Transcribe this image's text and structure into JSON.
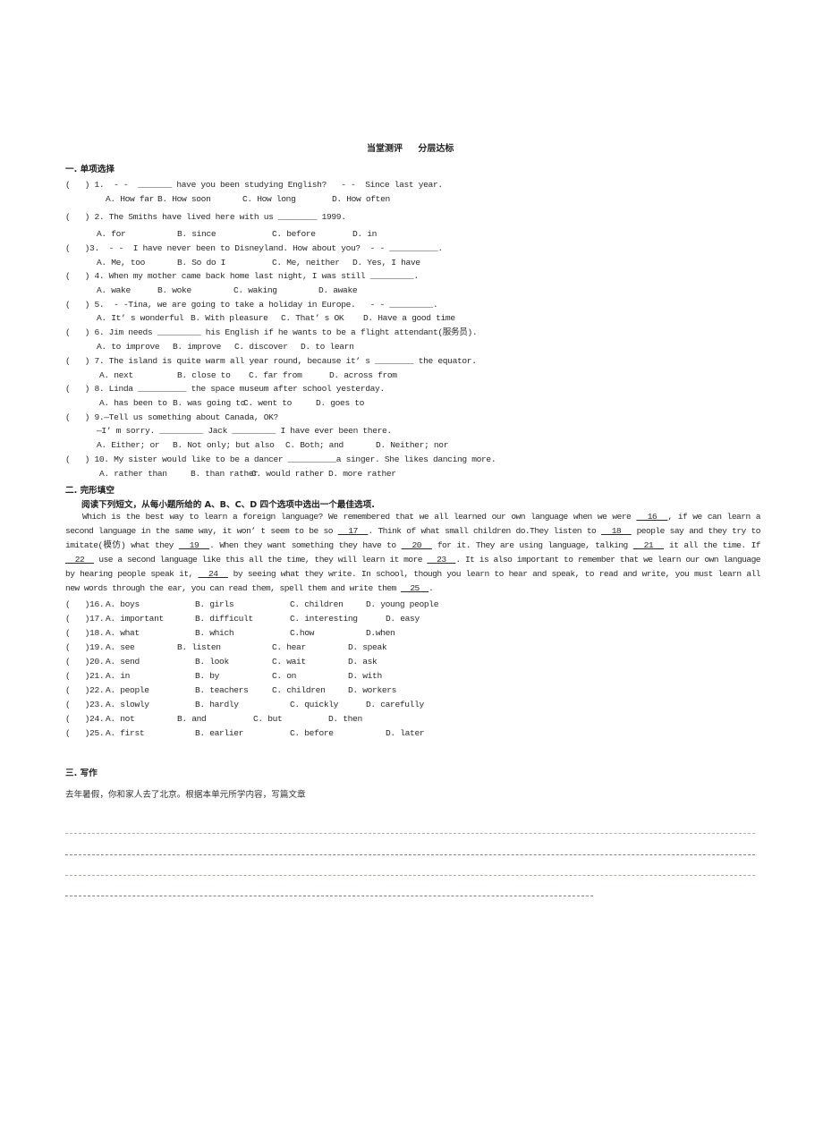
{
  "title": "当堂测评     分层达标",
  "section1": {
    "heading": "一. 单项选择",
    "questions": [
      {
        "stem": "(   ) 1.  - -  _______ have you been studying English?   - -  Since last year.",
        "options": [
          "A. How far",
          "B. How soon",
          "C. How long",
          "D. How often"
        ]
      },
      {
        "stem": "(   ) 2. The Smiths have lived here with us ________ 1999.",
        "options": [
          "A. for",
          "B. since",
          "C. before",
          "D. in"
        ]
      },
      {
        "stem": "(   )3.  - -  I have never been to Disneyland. How about you?  - - __________.",
        "options": [
          "A. Me, too",
          "B. So do I",
          "C. Me, neither",
          "D. Yes, I have"
        ]
      },
      {
        "stem": "(   ) 4. When my mother came back home last night, I was still _________.",
        "options": [
          "A. wake",
          "B. woke",
          "C. waking",
          "D. awake"
        ]
      },
      {
        "stem": "(   ) 5.  - -Tina, we are going to take a holiday in Europe.   - - _________.",
        "options": [
          "A. It’ s wonderful",
          "B. With pleasure",
          "C. That’ s OK",
          "D. Have a good time"
        ]
      },
      {
        "stem": "(   ) 6. Jim needs _________ his English if he wants to be a flight attendant(服务员).",
        "options": [
          "A. to improve",
          "B. improve",
          "C. discover",
          "D. to learn"
        ]
      },
      {
        "stem": "(   ) 7. The island is quite warm all year round, because it’ s ________ the equator.",
        "options": [
          "A. next",
          "B. close to",
          "C. far from",
          "D. across from"
        ]
      },
      {
        "stem": "(   ) 8. Linda __________ the space museum after school yesterday.",
        "options": [
          "A. has been to",
          "B. was going to",
          "C. went to",
          "D. goes to"
        ]
      },
      {
        "stem": "(   ) 9.—Tell us something about Canada, OK?",
        "stem2": "—I’ m sorry. _________ Jack _________ I have ever been there.",
        "options": [
          "A. Either; or",
          "B. Not only; but also",
          "C. Both; and",
          "D. Neither; nor"
        ]
      },
      {
        "stem": "(   ) 10. My sister would like to be a dancer __________a singer. She likes dancing more.",
        "options": [
          "A. rather than",
          "B. than rather",
          "C. would rather",
          "D. more rather"
        ]
      }
    ]
  },
  "section2": {
    "heading": "二. 完形填空",
    "instruction": "阅读下列短文，从每小题所给的 A、B、C、D 四个选项中选出一个最佳选项.",
    "passage": [
      {
        "t": "Which is the best way to learn a foreign language? We remembered that we all learned our own language when we were "
      },
      {
        "b": "16"
      },
      {
        "t": ", if we can learn a second language in the same way, it won’ t seem to be so "
      },
      {
        "b": "17"
      },
      {
        "t": ". Think of what small children do.They listen to "
      },
      {
        "b": "18"
      },
      {
        "t": " people say and they try to imitate(模仿) what they "
      },
      {
        "b": "19"
      },
      {
        "t": ". When they want something they have to "
      },
      {
        "b": "20"
      },
      {
        "t": " for it. They are using language, talking "
      },
      {
        "b": "21"
      },
      {
        "t": " it all the time. If "
      },
      {
        "b": "22"
      },
      {
        "t": " use a second language like this all the time, they will learn it more "
      },
      {
        "b": "23"
      },
      {
        "t": ". It is also important to remember that we learn our own language by hearing people speak it, "
      },
      {
        "b": "24"
      },
      {
        "t": " by seeing what they write. In school, though you learn to hear and speak, to read and write, you must learn all new words through the ear, you can read them, spell them and write them "
      },
      {
        "b": "25"
      },
      {
        "t": "."
      }
    ],
    "questions": [
      {
        "num": "(   )16.",
        "options": [
          "A. boys",
          "B. girls",
          "C. children",
          "D. young people"
        ]
      },
      {
        "num": "(   )17.",
        "options": [
          "A. important",
          "B. difficult",
          "C. interesting",
          "D. easy"
        ]
      },
      {
        "num": "(   )18.",
        "options": [
          "A. what",
          "B. which",
          "C.how",
          "D.when"
        ]
      },
      {
        "num": "(   )19.",
        "options": [
          "A. see",
          "B. listen",
          "C. hear",
          "D. speak"
        ]
      },
      {
        "num": "(   )20.",
        "options": [
          "A. send",
          "B. look",
          "C. wait",
          "D. ask"
        ]
      },
      {
        "num": "(   )21.",
        "options": [
          "A. in",
          "B. by",
          "C. on",
          "D. with"
        ]
      },
      {
        "num": "(   )22.",
        "options": [
          "A. people",
          "B. teachers",
          "C. children",
          "D. workers"
        ]
      },
      {
        "num": "(   )23.",
        "options": [
          "A. slowly",
          "B. hardly",
          "C. quickly",
          "D. carefully"
        ]
      },
      {
        "num": "(   )24.",
        "options": [
          "A. not",
          "B. and",
          "C. but",
          "D. then"
        ]
      },
      {
        "num": "(   )25.",
        "options": [
          "A. first",
          "B. earlier",
          "C. before",
          "D. later"
        ]
      }
    ]
  },
  "section3": {
    "heading": "三. 写作",
    "prompt": "去年暑假，你和家人去了北京。根据本单元所学内容，写篇文章",
    "line_colors": [
      "#a9b3a6",
      "#8e7a92",
      "#9fb39a",
      "#8e7a92"
    ]
  }
}
